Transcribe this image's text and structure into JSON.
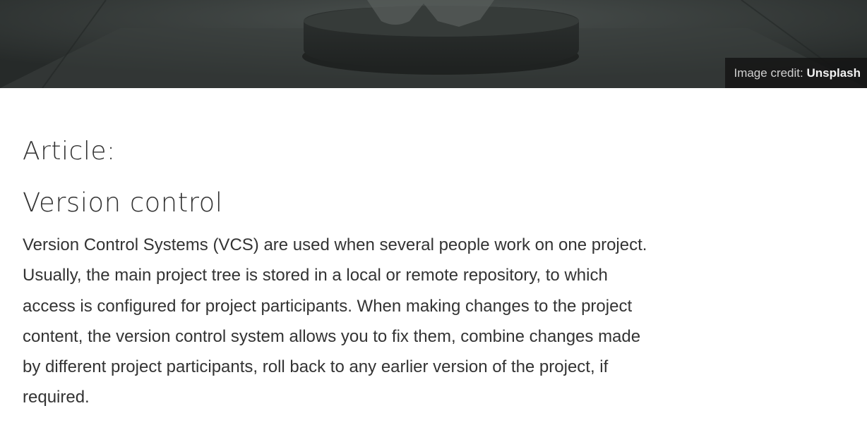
{
  "hero": {
    "image_name": "figurine-on-pedestal",
    "credit_prefix": "Image credit: ",
    "credit_source": "Unsplash"
  },
  "article": {
    "eyebrow": "Article:",
    "title": "Version control",
    "body": "Version Control Systems (VCS) are used when several people work on one project. Usually, the main project tree is stored in a local or remote repository, to which access is configured for project participants. When making changes to the project content, the version control system allows you to fix them, combine changes made by different project participants, roll back to any earlier version of the project, if required."
  }
}
